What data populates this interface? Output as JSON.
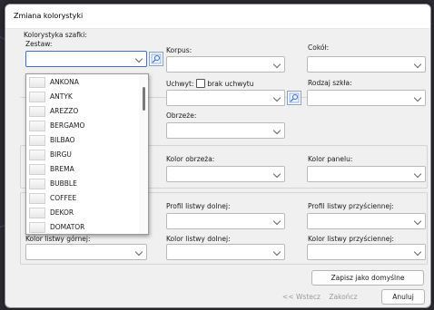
{
  "window": {
    "title": "Zmiana kolorystyki"
  },
  "group": {
    "label": "Kolorystyka szafki:"
  },
  "fields": {
    "zestaw": "Zestaw:",
    "korpus": "Korpus:",
    "cokol": "Cokół:",
    "uchwyt": "Uchwyt:",
    "brak_uchwytu": "brak uchwytu",
    "rodzaj_szkla": "Rodzaj szkła:",
    "obrzeze": "Obrzeże:",
    "kolor_obrzeza": "Kolor obrzeża:",
    "kolor_panelu": "Kolor panelu:",
    "profil_dolnej": "Profil listwy dolnej:",
    "profil_przysciennej": "Profil listwy przyściennej:",
    "kolor_gornej": "Kolor listwy górnej:",
    "kolor_dolnej": "Kolor listwy dolnej:",
    "kolor_przysciennej": "Kolor listwy przyściennej:"
  },
  "dropdown": {
    "items": [
      "ANKONA",
      "ANTYK",
      "AREZZO",
      "BERGAMO",
      "BILBAO",
      "BIRGU",
      "BREMA",
      "BUBBLE",
      "COFFEE",
      "DEKOR",
      "DOMATOR"
    ]
  },
  "buttons": {
    "save_default": "Zapisz jako domyślne",
    "back": "<< Wstecz",
    "finish": "Zakończ",
    "cancel": "Anuluj"
  }
}
